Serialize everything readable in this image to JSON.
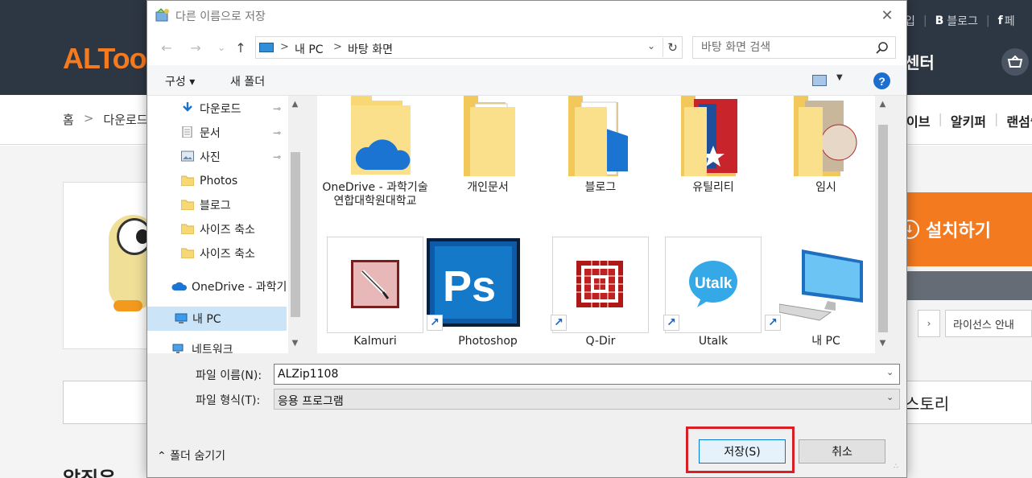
{
  "site": {
    "logo": "ALToo",
    "top_links": {
      "join": "입",
      "blog_mark": "B",
      "blog": "블로그",
      "facebook_mark": "f",
      "facebook": "페"
    },
    "center": "센터",
    "breadcrumb": {
      "home": "홈",
      "sep": ">",
      "download": "다운로드"
    },
    "nav_right": [
      "이브",
      "알키퍼",
      "랜섬쉴"
    ],
    "install_button": "설치하기",
    "pager_next": "›",
    "license_button": "라이선스 안내",
    "tab_history": "스토리",
    "section_title": "알집은"
  },
  "dialog": {
    "title": "다른 이름으로 저장",
    "close": "✕",
    "nav": {
      "back": "←",
      "forward": "→",
      "recent": "⌄",
      "up": "↑"
    },
    "address": {
      "root": "내 PC",
      "current": "바탕 화면",
      "chevron": ">",
      "dropdown": "⌄",
      "refresh": "↻"
    },
    "search": {
      "placeholder": "바탕 화면 검색"
    },
    "toolbar": {
      "organize": "구성 ▾",
      "new_folder": "새 폴더",
      "view_drop": "▼",
      "help": "?"
    },
    "nav_pane": [
      {
        "label": "다운로드",
        "icon": "download-arrow-icon",
        "pinned": true
      },
      {
        "label": "문서",
        "icon": "document-icon",
        "pinned": true
      },
      {
        "label": "사진",
        "icon": "picture-icon",
        "pinned": true
      },
      {
        "label": "Photos",
        "icon": "folder-icon",
        "pinned": false
      },
      {
        "label": "블로그",
        "icon": "folder-icon",
        "pinned": false
      },
      {
        "label": "사이즈 축소",
        "icon": "folder-icon",
        "pinned": false
      },
      {
        "label": "사이즈 축소",
        "icon": "folder-icon",
        "pinned": false
      },
      {
        "label": "OneDrive - 과학기",
        "icon": "onedrive-cloud-icon",
        "pinned": false
      },
      {
        "label": "내 PC",
        "icon": "computer-icon",
        "pinned": false,
        "selected": true
      },
      {
        "label": "네트워크",
        "icon": "network-icon",
        "pinned": false
      }
    ],
    "pin": "📌",
    "scroll": {
      "up": "▲",
      "down": "▼"
    },
    "files_row1": [
      {
        "label": "OneDrive - 과학기술연합대학원대학교",
        "icon": "onedrive-folder-icon"
      },
      {
        "label": "개인문서",
        "icon": "folder-icon"
      },
      {
        "label": "블로그",
        "icon": "folder-icon"
      },
      {
        "label": "유틸리티",
        "icon": "folder-icon"
      },
      {
        "label": "임시",
        "icon": "folder-icon"
      }
    ],
    "files_row2": [
      {
        "label": "Kalmuri",
        "icon": "kalmuri-app-icon"
      },
      {
        "label": "Photoshop",
        "icon": "photoshop-app-icon",
        "ps": "Ps"
      },
      {
        "label": "Q-Dir",
        "icon": "qdir-app-icon"
      },
      {
        "label": "Utalk",
        "icon": "utalk-app-icon",
        "text": "Utalk"
      },
      {
        "label": "내 PC",
        "icon": "computer-icon"
      }
    ],
    "shortcut_arrow": "↗",
    "form": {
      "filename_label": "파일 이름(N):",
      "filename_value": "ALZip1108",
      "filetype_label": "파일 형식(T):",
      "filetype_value": "응용 프로그램",
      "combo_arrow": "⌄"
    },
    "hide_folders": "⌃  폴더 숨기기",
    "save_button": "저장(S)",
    "cancel_button": "취소",
    "colors": {
      "highlight": "#d81f26",
      "accent": "#0078d7",
      "folder": "#f8d775",
      "brand_orange": "#f47a20"
    }
  }
}
